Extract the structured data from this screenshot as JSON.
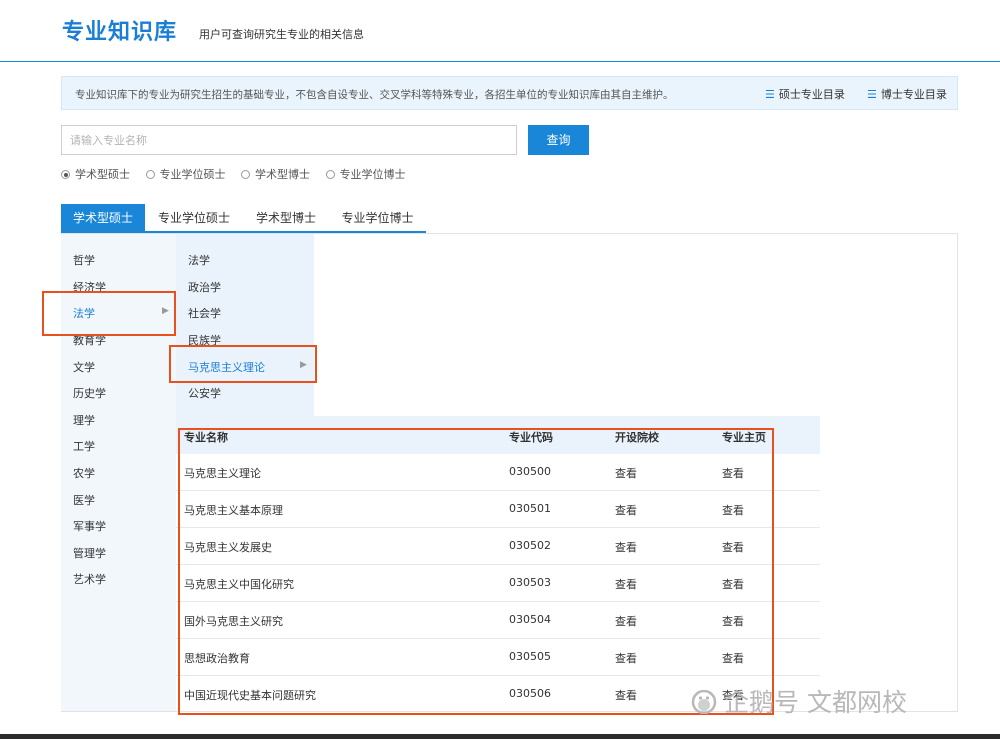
{
  "header": {
    "brand": "专业知识库",
    "subtitle": "用户可查询研究生专业的相关信息"
  },
  "notice": {
    "text": "专业知识库下的专业为研究生招生的基础专业，不包含自设专业、交叉学科等特殊专业，各招生单位的专业知识库由其自主维护。",
    "master_link": "硕士专业目录",
    "doctor_link": "博士专业目录",
    "list_icon": "list-icon"
  },
  "search": {
    "placeholder": "请输入专业名称",
    "value": "",
    "button_label": "查询"
  },
  "radios": [
    {
      "label": "学术型硕士",
      "selected": true
    },
    {
      "label": "专业学位硕士",
      "selected": false
    },
    {
      "label": "学术型博士",
      "selected": false
    },
    {
      "label": "专业学位博士",
      "selected": false
    }
  ],
  "tabs": [
    {
      "label": "学术型硕士",
      "active": true
    },
    {
      "label": "专业学位硕士",
      "active": false
    },
    {
      "label": "学术型博士",
      "active": false
    },
    {
      "label": "专业学位博士",
      "active": false
    }
  ],
  "categories": [
    "哲学",
    "经济学",
    "法学",
    "教育学",
    "文学",
    "历史学",
    "理学",
    "工学",
    "农学",
    "医学",
    "军事学",
    "管理学",
    "艺术学"
  ],
  "active_category": "法学",
  "subcategories": [
    "法学",
    "政治学",
    "社会学",
    "民族学",
    "马克思主义理论",
    "公安学"
  ],
  "active_subcategory": "马克思主义理论",
  "table": {
    "headers": [
      "专业名称",
      "专业代码",
      "开设院校",
      "专业主页"
    ],
    "rows": [
      [
        "马克思主义理论",
        "030500",
        "查看",
        "查看"
      ],
      [
        "马克思主义基本原理",
        "030501",
        "查看",
        "查看"
      ],
      [
        "马克思主义发展史",
        "030502",
        "查看",
        "查看"
      ],
      [
        "马克思主义中国化研究",
        "030503",
        "查看",
        "查看"
      ],
      [
        "国外马克思主义研究",
        "030504",
        "查看",
        "查看"
      ],
      [
        "思想政治教育",
        "030505",
        "查看",
        "查看"
      ],
      [
        "中国近现代史基本问题研究",
        "030506",
        "查看",
        "查看"
      ]
    ]
  },
  "watermark": {
    "text": "企鹅号 文都网校",
    "icon": "penguin-icon"
  },
  "colors": {
    "accent": "#1a86d8",
    "highlight": "#e8501d",
    "sidebar_bg": "#f2f7fc"
  }
}
